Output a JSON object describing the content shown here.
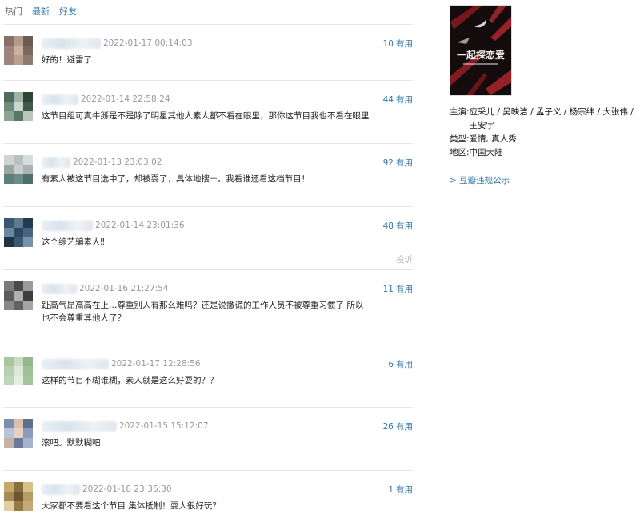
{
  "tabs": [
    {
      "label": "热门",
      "active": true
    },
    {
      "label": "最新",
      "active": false
    },
    {
      "label": "好友",
      "active": false
    }
  ],
  "comments": [
    {
      "time": "2022-01-17 00:14:03",
      "votes": "10",
      "useful": "有用",
      "text": "好的！避雷了",
      "avatar": [
        "#8a6f64",
        "#b59a8a",
        "#6d5a55",
        "#a3847a",
        "#c9b1a0",
        "#7b6660",
        "#9c857a",
        "#b89f90",
        "#8d7a70"
      ]
    },
    {
      "time": "2022-01-14 22:58:24",
      "votes": "44",
      "useful": "有用",
      "text": "这节目组可真牛掰是不是除了明星其他人素人都不看在眼里，那你这节目我也不看在眼里",
      "avatar": [
        "#4f6b5b",
        "#9fb3a5",
        "#2f4237",
        "#6f8c7a",
        "#c8d6cb",
        "#3e5a4a",
        "#8aa394",
        "#587565",
        "#b7c8bb"
      ]
    },
    {
      "time": "2022-01-13 23:03:02",
      "votes": "92",
      "useful": "有用",
      "text": "有素人被这节目选中了，却被耍了，具体地搜ㅡ。我看谁还看这档节目！",
      "avatar": [
        "#cfd3d2",
        "#b9c0bf",
        "#d8dcdb",
        "#9aa6a4",
        "#c7cecd",
        "#a9b3b1",
        "#5f7f7d",
        "#6d8b89",
        "#4f6f6d"
      ]
    },
    {
      "time": "2022-01-14 23:01:36",
      "votes": "48",
      "useful": "有用",
      "text": "这个综艺骗素人‼",
      "report": "投诉",
      "avatar": [
        "#3a5670",
        "#5d7a93",
        "#253b50",
        "#6a86a0",
        "#2d4a63",
        "#48657e",
        "#1f3346",
        "#3d5870",
        "#7793ab"
      ]
    },
    {
      "time": "2022-01-16 21:27:54",
      "votes": "11",
      "useful": "有用",
      "text": "趾高气昂高高在上…尊重别人有那么难吗？还是说撒谎的工作人员不被尊重习惯了 所以也不会尊重其他人了？",
      "avatar": [
        "#7a7a7a",
        "#4a4a4a",
        "#9b9b9b",
        "#5c5c5c",
        "#b0b0b0",
        "#3d3d3d",
        "#888888",
        "#626262",
        "#a5a5a5"
      ]
    },
    {
      "time": "2022-01-17 12:28:56",
      "votes": "6",
      "useful": "有用",
      "text": "这样的节目不糊谁糊，素人就是这么好耍的？？",
      "avatar": [
        "#a8c7a1",
        "#c9dcc4",
        "#93b98b",
        "#b5d0ae",
        "#dbe8d7",
        "#9ec296",
        "#c0d6ba",
        "#e4eee1",
        "#a3c39c"
      ]
    },
    {
      "time": "2022-01-15 15:12:07",
      "votes": "26",
      "useful": "有用",
      "text": "滚吧。默默糊吧",
      "avatar": [
        "#7d8fb0",
        "#d9c0b0",
        "#5e6f8d",
        "#b8c4d8",
        "#e6d3c6",
        "#8a9bbb",
        "#c7b2a4",
        "#6a7b9a",
        "#a5b3cc"
      ]
    },
    {
      "time": "2022-01-18 23:36:30",
      "votes": "1",
      "useful": "有用",
      "text": "大家都不要看这个节目 集体抵制！耍人很好玩？",
      "avatar": [
        "#c6a86a",
        "#8a6f3c",
        "#d8c08a",
        "#a58a55",
        "#6d5630",
        "#b99c63",
        "#e1cfa1",
        "#957a46",
        "#c2a978"
      ]
    }
  ],
  "side": {
    "poster_title": "一起探恋爱",
    "info": [
      {
        "label": "主演:",
        "value": "应采儿 / 吴映洁 / 孟子义 / 杨宗纬 / 大张伟 / 王安宇"
      },
      {
        "label": "类型:",
        "value": "爱情, 真人秀"
      },
      {
        "label": "地区:",
        "value": "中国大陆"
      }
    ],
    "policy_link": "> 豆瓣违规公示"
  },
  "colors": {
    "link": "#3377aa",
    "time": "#999999",
    "divider": "#e6e6e6"
  }
}
